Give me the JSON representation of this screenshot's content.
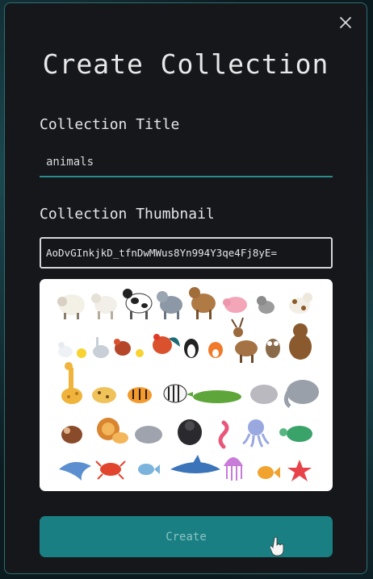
{
  "modal": {
    "title": "Create Collection",
    "close_icon": "close-icon"
  },
  "form": {
    "title_label": "Collection Title",
    "title_value": "animals",
    "thumbnail_label": "Collection Thumbnail",
    "thumbnail_value": "AoDvGInkjkD_tfnDwMWus8Yn994Y3qe4Fj8yE="
  },
  "thumbnail_preview": {
    "subject": "cartoon animals collage",
    "animals": [
      "sheep",
      "goat",
      "cow",
      "donkey",
      "horse",
      "pig",
      "cat",
      "dog",
      "duck",
      "duckling",
      "goose",
      "hen",
      "chick",
      "rooster",
      "penguin",
      "fox",
      "deer",
      "owl",
      "bear",
      "giraffe",
      "leopard",
      "tiger",
      "zebra",
      "crocodile",
      "hippo",
      "elephant",
      "monkey",
      "lion",
      "hippo",
      "gorilla",
      "seahorse",
      "octopus",
      "turtle",
      "dolphin",
      "crab",
      "fish",
      "shark",
      "jellyfish",
      "goldfish",
      "starfish"
    ]
  },
  "actions": {
    "create_label": "Create"
  },
  "colors": {
    "accent": "#1a7f82",
    "modal_bg": "#15171b",
    "border": "#2e6e70"
  }
}
